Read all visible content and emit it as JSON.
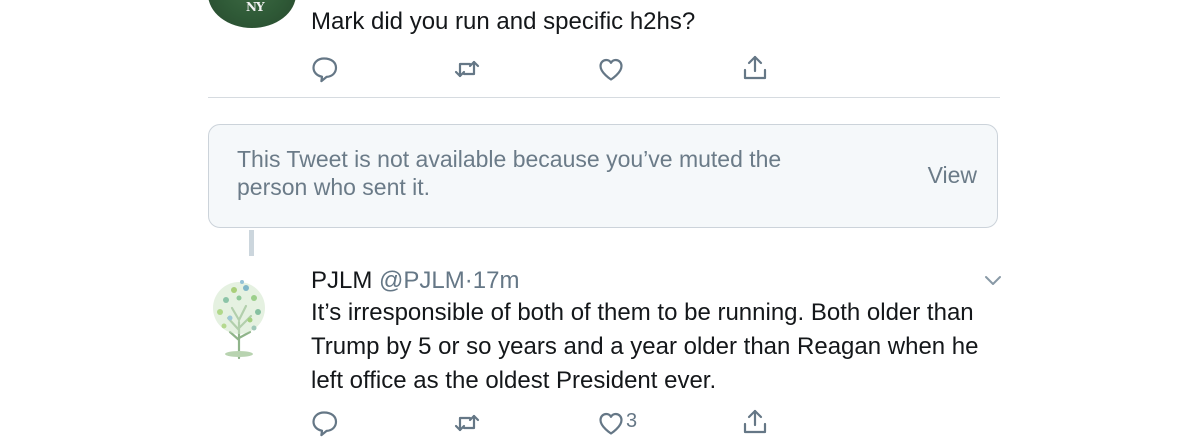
{
  "top_tweet": {
    "text": "Mark did you run and specific h2hs?",
    "avatar_logo_text": "NY"
  },
  "muted_notice": {
    "message": "This Tweet is not available because you’ve muted the person who sent it.",
    "view_label": "View"
  },
  "tweet": {
    "name": "PJLM",
    "handle": "@PJLM",
    "separator": "·",
    "time": "17m",
    "text": "It’s irresponsible of both of them to be running. Both older than Trump by 5 or so years and a year older than Reagan when he left office as the oldest President ever.",
    "like_count": "3"
  },
  "icons": {
    "reply": "reply-icon",
    "retweet": "retweet-icon",
    "like": "heart-icon",
    "share": "share-icon",
    "more": "chevron-down-icon"
  },
  "colors": {
    "icon_gray": "#657786",
    "muted_text": "#6b7b88",
    "muted_bg": "#f5f8fa",
    "divider": "#d6dbe0"
  }
}
